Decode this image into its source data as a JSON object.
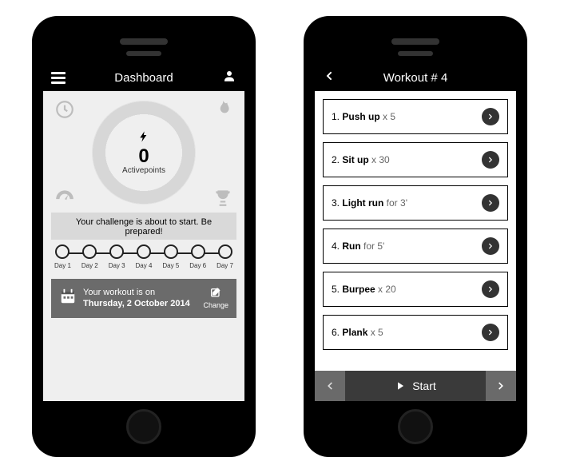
{
  "dashboard": {
    "title": "Dashboard",
    "gauge": {
      "score": "0",
      "label": "Activepoints"
    },
    "banner": "Your challenge is about to start. Be prepared!",
    "days": [
      "Day 1",
      "Day 2",
      "Day 3",
      "Day 4",
      "Day 5",
      "Day 6",
      "Day 7"
    ],
    "workout_prefix": "Your workout is on",
    "workout_date": "Thursday, 2 October 2014",
    "change_label": "Change"
  },
  "workout": {
    "title": "Workout # 4",
    "items": [
      {
        "num": "1.",
        "name": "Push up",
        "tail": " x 5"
      },
      {
        "num": "2.",
        "name": "Sit up",
        "tail": " x 30"
      },
      {
        "num": "3.",
        "name": "Light run",
        "tail": " for 3'"
      },
      {
        "num": "4.",
        "name": "Run",
        "tail": " for 5'"
      },
      {
        "num": "5.",
        "name": "Burpee",
        "tail": " x 20"
      },
      {
        "num": "6.",
        "name": "Plank",
        "tail": " x 5"
      }
    ],
    "start_label": "Start"
  }
}
